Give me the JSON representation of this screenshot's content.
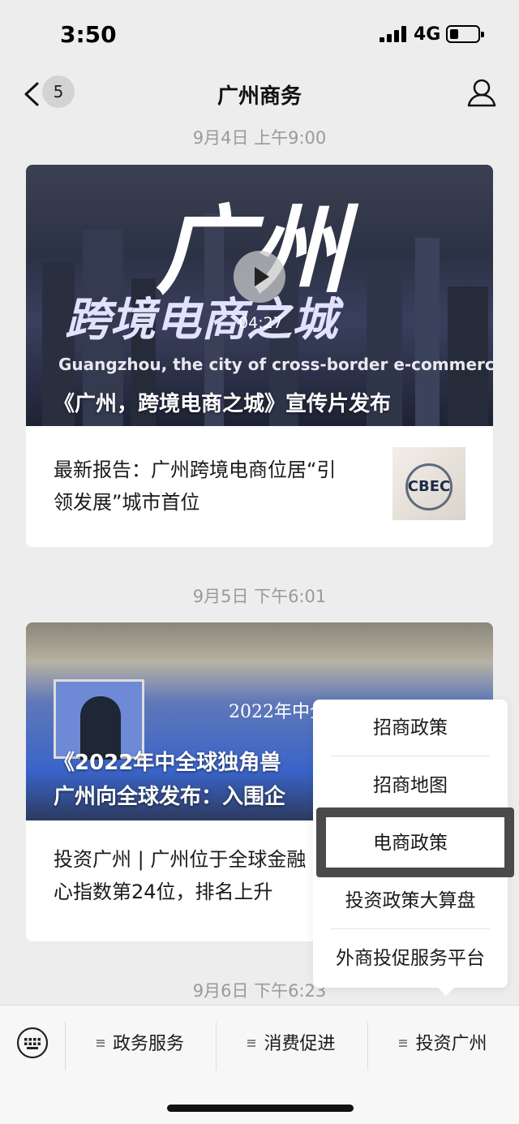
{
  "status_bar": {
    "time": "3:50",
    "network": "4G"
  },
  "nav": {
    "unread_count": "5",
    "title": "广州商务"
  },
  "articles": [
    {
      "timestamp": "9月4日 上午9:00",
      "hero_title": "《广州，跨境电商之城》宣传片发布",
      "video_duration": "04:27",
      "hero_big_text": "广州",
      "hero_city_line": "跨境电商之城",
      "hero_english": "Guangzhou, the city of cross-border e-commerce",
      "items": [
        {
          "title": "最新报告：广州跨境电商位居“引领发展”城市首位",
          "line1": "最新报告：广州跨境电商位居“引",
          "line2": "领发展”城市首位",
          "thumb_text": "CBEC"
        }
      ]
    },
    {
      "timestamp": "9月5日 下午6:01",
      "hero_title_line1": "《2022年中全球独角兽",
      "hero_title_line2": "广州向全球发布：入围企",
      "hero_top_text": "2022年中全",
      "items": [
        {
          "line1": "投资广州 | 广州位于全球金融",
          "line2": "心指数第24位，排名上升"
        }
      ]
    }
  ],
  "next_timestamp": "9月6日 下午6:23",
  "dropdown_menu": {
    "items": [
      "招商政策",
      "招商地图",
      "电商政策",
      "投资政策大算盘",
      "外商投促服务平台"
    ],
    "highlighted": "电商政策"
  },
  "bottom_menu": {
    "tabs": [
      "政务服务",
      "消费促进",
      "投资广州"
    ]
  },
  "icons": {
    "back": "chevron-left-icon",
    "profile": "person-icon",
    "keyboard": "keyboard-icon",
    "play": "play-icon"
  }
}
